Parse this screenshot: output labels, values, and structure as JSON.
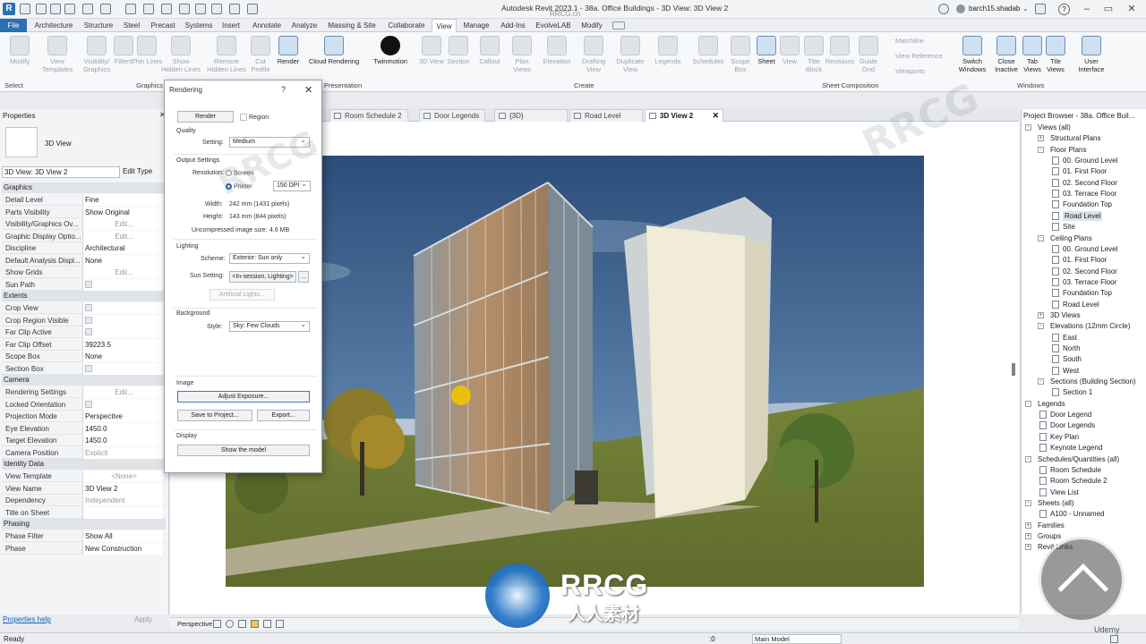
{
  "app": {
    "title": "Autodesk Revit 2023.1 - 38a. Office Buildings - 3D View: 3D View 2",
    "user": "barch15.shadab",
    "watermark_top": "RRCG.cn"
  },
  "menu_tabs": [
    "File",
    "Architecture",
    "Structure",
    "Steel",
    "Precast",
    "Systems",
    "Insert",
    "Annotate",
    "Analyze",
    "Massing & Site",
    "Collaborate",
    "View",
    "Manage",
    "Add-Ins",
    "EvolveLAB",
    "Modify"
  ],
  "ribbon": {
    "select_label": "Select",
    "graphics": {
      "label": "Graphics",
      "buttons": [
        "Modify",
        "View Templates",
        "Visibility/ Graphics",
        "Filters",
        "Thin Lines",
        "Show Hidden Lines",
        "Remove Hidden Lines",
        "Cut Profile"
      ]
    },
    "presentation": {
      "label": "Presentation",
      "buttons": [
        "Render",
        "Cloud Rendering",
        "Twinmotion"
      ]
    },
    "create": {
      "label": "Create",
      "buttons": [
        "3D View",
        "Section",
        "Callout",
        "Plan Views",
        "Elevation",
        "Drafting View",
        "Duplicate View",
        "Legends",
        "Schedules",
        "Scope Box"
      ]
    },
    "sheet_composition": {
      "label": "Sheet Composition",
      "buttons": [
        "Sheet",
        "View",
        "Title Block",
        "Revisions",
        "Guide Grid",
        "Matchline",
        "View Reference",
        "Viewports"
      ]
    },
    "windows": {
      "label": "Windows",
      "buttons": [
        "Switch Windows",
        "Close Inactive",
        "Tab Views",
        "Tile Views",
        "User Interface"
      ]
    }
  },
  "view_tabs": [
    {
      "label": "Room Schedule 2",
      "active": false
    },
    {
      "label": "Door Legends",
      "active": false
    },
    {
      "label": "{3D}",
      "active": false
    },
    {
      "label": "Road Level",
      "active": false
    },
    {
      "label": "3D View 2",
      "active": true
    }
  ],
  "properties": {
    "title": "Properties",
    "type_name": "3D View",
    "selector": "3D View: 3D View 2",
    "edit_type": "Edit Type",
    "sections": [
      {
        "name": "Graphics",
        "rows": [
          {
            "k": "Detail Level",
            "v": "Fine"
          },
          {
            "k": "Parts Visibility",
            "v": "Show Original"
          },
          {
            "k": "Visibility/Graphics Ov...",
            "v": "Edit...",
            "btn": true
          },
          {
            "k": "Graphic Display Optio...",
            "v": "Edit...",
            "btn": true
          },
          {
            "k": "Discipline",
            "v": "Architectural"
          },
          {
            "k": "Default Analysis Displ...",
            "v": "None"
          },
          {
            "k": "Show Grids",
            "v": "Edit...",
            "btn": true
          },
          {
            "k": "Sun Path",
            "v": "",
            "chk": true
          }
        ]
      },
      {
        "name": "Extents",
        "rows": [
          {
            "k": "Crop View",
            "v": "",
            "chk": true
          },
          {
            "k": "Crop Region Visible",
            "v": "",
            "chk": true
          },
          {
            "k": "Far Clip Active",
            "v": "",
            "chk": true
          },
          {
            "k": "Far Clip Offset",
            "v": "39223.5"
          },
          {
            "k": "Scope Box",
            "v": "None"
          },
          {
            "k": "Section Box",
            "v": "",
            "chk": true
          }
        ]
      },
      {
        "name": "Camera",
        "rows": [
          {
            "k": "Rendering Settings",
            "v": "Edit...",
            "btn": true
          },
          {
            "k": "Locked Orientation",
            "v": "",
            "chk": true,
            "gray": true
          },
          {
            "k": "Projection Mode",
            "v": "Perspective"
          },
          {
            "k": "Eye Elevation",
            "v": "1450.0"
          },
          {
            "k": "Target Elevation",
            "v": "1450.0"
          },
          {
            "k": "Camera Position",
            "v": "Explicit",
            "gray": true
          }
        ]
      },
      {
        "name": "Identity Data",
        "rows": [
          {
            "k": "View Template",
            "v": "<None>",
            "btn": true
          },
          {
            "k": "View Name",
            "v": "3D View 2"
          },
          {
            "k": "Dependency",
            "v": "Independent",
            "gray": true
          },
          {
            "k": "Title on Sheet",
            "v": ""
          }
        ]
      },
      {
        "name": "Phasing",
        "rows": [
          {
            "k": "Phase Filter",
            "v": "Show All"
          },
          {
            "k": "Phase",
            "v": "New Construction"
          }
        ]
      }
    ],
    "help": "Properties help",
    "apply": "Apply"
  },
  "dialog": {
    "title": "Rendering",
    "help": "?",
    "render": "Render",
    "region": "Region",
    "quality": "Quality",
    "setting_label": "Setting:",
    "setting": "Medium",
    "output": "Output Settings",
    "resolution_label": "Resolution:",
    "screen": "Screen",
    "printer": "Printer",
    "dpi": "150 DPI",
    "width_label": "Width:",
    "width": "242 mm (1431 pixels)",
    "height_label": "Height:",
    "height": "143 mm (844 pixels)",
    "size_label": "Uncompressed image size:",
    "size": "4.6 MB",
    "lighting": "Lighting",
    "scheme_label": "Scheme:",
    "scheme": "Exterior: Sun only",
    "sun_label": "Sun Setting:",
    "sun": "<In-session, Lighting>",
    "sun_more": "...",
    "artificial": "Artificial Lights...",
    "background": "Background",
    "style_label": "Style:",
    "style": "Sky: Few Clouds",
    "image": "Image",
    "adjust": "Adjust Exposure...",
    "save": "Save to Project...",
    "export": "Export...",
    "display": "Display",
    "show_model": "Show the model"
  },
  "browser": {
    "title": "Project Browser - 38a. Office Buil...",
    "items": [
      {
        "t": "Views (all)",
        "lvl": 0,
        "exp": "-"
      },
      {
        "t": "Structural Plans",
        "lvl": 1,
        "exp": "+"
      },
      {
        "t": "Floor Plans",
        "lvl": 1,
        "exp": "-"
      },
      {
        "t": "00. Ground Level",
        "lvl": 2
      },
      {
        "t": "01. First Floor",
        "lvl": 2
      },
      {
        "t": "02. Second Floor",
        "lvl": 2
      },
      {
        "t": "03. Terrace Floor",
        "lvl": 2
      },
      {
        "t": "Foundation Top",
        "lvl": 2
      },
      {
        "t": "Road Level",
        "lvl": 2,
        "sel": true
      },
      {
        "t": "Site",
        "lvl": 2
      },
      {
        "t": "Ceiling Plans",
        "lvl": 1,
        "exp": "-"
      },
      {
        "t": "00. Ground Level",
        "lvl": 2
      },
      {
        "t": "01. First Floor",
        "lvl": 2
      },
      {
        "t": "02. Second Floor",
        "lvl": 2
      },
      {
        "t": "03. Terrace Floor",
        "lvl": 2
      },
      {
        "t": "Foundation Top",
        "lvl": 2
      },
      {
        "t": "Road Level",
        "lvl": 2
      },
      {
        "t": "3D Views",
        "lvl": 1,
        "exp": "+"
      },
      {
        "t": "Elevations (12mm Circle)",
        "lvl": 1,
        "exp": "-"
      },
      {
        "t": "East",
        "lvl": 2
      },
      {
        "t": "North",
        "lvl": 2
      },
      {
        "t": "South",
        "lvl": 2
      },
      {
        "t": "West",
        "lvl": 2
      },
      {
        "t": "Sections (Building Section)",
        "lvl": 1,
        "exp": "-"
      },
      {
        "t": "Section 1",
        "lvl": 2
      },
      {
        "t": "Legends",
        "lvl": 0,
        "exp": "-"
      },
      {
        "t": "Door Legend",
        "lvl": 1
      },
      {
        "t": "Door Legends",
        "lvl": 1
      },
      {
        "t": "Key Plan",
        "lvl": 1
      },
      {
        "t": "Keynote Legend",
        "lvl": 1
      },
      {
        "t": "Schedules/Quantities (all)",
        "lvl": 0,
        "exp": "-"
      },
      {
        "t": "Room Schedule",
        "lvl": 1
      },
      {
        "t": "Room Schedule 2",
        "lvl": 1
      },
      {
        "t": "View List",
        "lvl": 1
      },
      {
        "t": "Sheets (all)",
        "lvl": 0,
        "exp": "-"
      },
      {
        "t": "A100 - Unnamed",
        "lvl": 1
      },
      {
        "t": "Families",
        "lvl": 0,
        "exp": "+"
      },
      {
        "t": "Groups",
        "lvl": 0,
        "exp": "+"
      },
      {
        "t": "Revit Links",
        "lvl": 0,
        "exp": "+"
      }
    ]
  },
  "view_control": {
    "mode": "Perspective"
  },
  "status": {
    "text": "Ready",
    "zero": ":0",
    "model": "Main Model"
  },
  "overlay": {
    "logo_big": "RRCG",
    "logo_sub": "人人素材",
    "udemy": "Udemy"
  },
  "colors": {
    "accent": "#2c6fb3",
    "cursor": "#f2c500"
  }
}
